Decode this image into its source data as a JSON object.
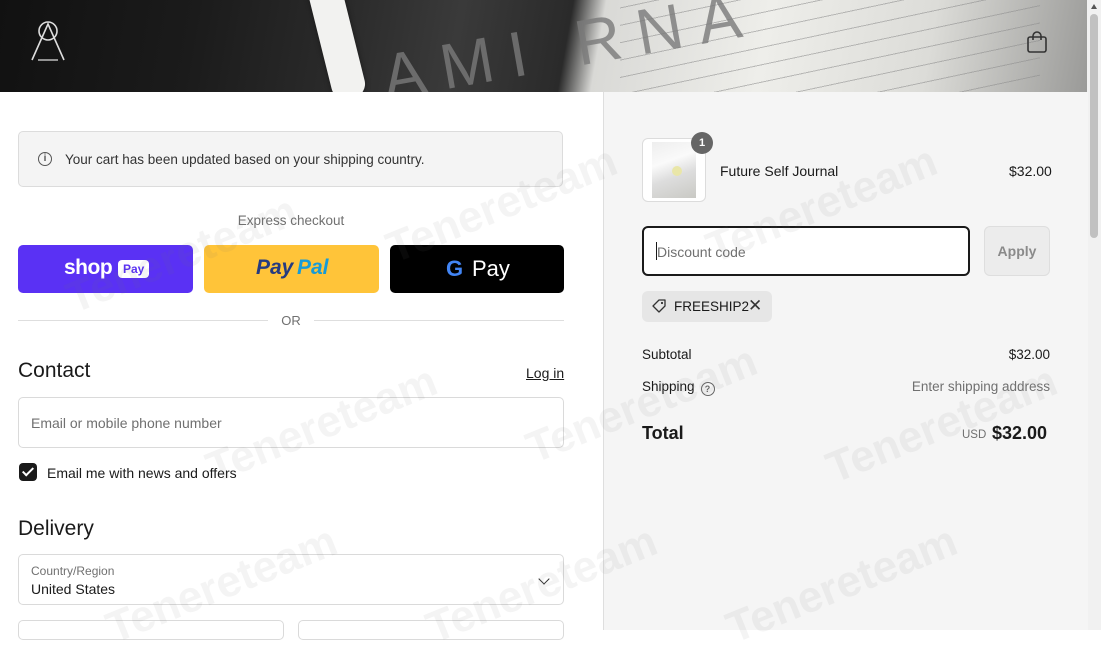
{
  "header": {
    "logo_icon": "triangle-logo-icon",
    "cart_icon": "shopping-bag-icon"
  },
  "notice": {
    "icon": "info-icon",
    "text": "Your cart has been updated based on your shipping country."
  },
  "express": {
    "label": "Express checkout",
    "shop_pay": {
      "brand": "shop",
      "pill": "Pay"
    },
    "paypal": {
      "part1": "Pay",
      "part2": "Pal"
    },
    "gpay": {
      "g": "G",
      "text": "Pay"
    },
    "or_label": "OR"
  },
  "contact": {
    "heading": "Contact",
    "login_link": "Log in",
    "email_placeholder": "Email or mobile phone number",
    "newsletter_label": "Email me with news and offers",
    "newsletter_checked": true
  },
  "delivery": {
    "heading": "Delivery",
    "country_label": "Country/Region",
    "country_value": "United States"
  },
  "summary": {
    "product": {
      "name": "Future Self Journal",
      "price": "$32.00",
      "quantity": "1"
    },
    "discount_placeholder": "Discount code",
    "apply_label": "Apply",
    "applied_code": "FREESHIP2",
    "subtotal_label": "Subtotal",
    "subtotal_value": "$32.00",
    "shipping_label": "Shipping",
    "shipping_value": "Enter shipping address",
    "total_label": "Total",
    "currency": "USD",
    "total_value": "$32.00"
  },
  "colors": {
    "shop_pay": "#5a31f4",
    "paypal": "#ffc439",
    "gpay": "#000000",
    "summary_bg": "#f5f5f5"
  },
  "watermark": "Tenereteam"
}
